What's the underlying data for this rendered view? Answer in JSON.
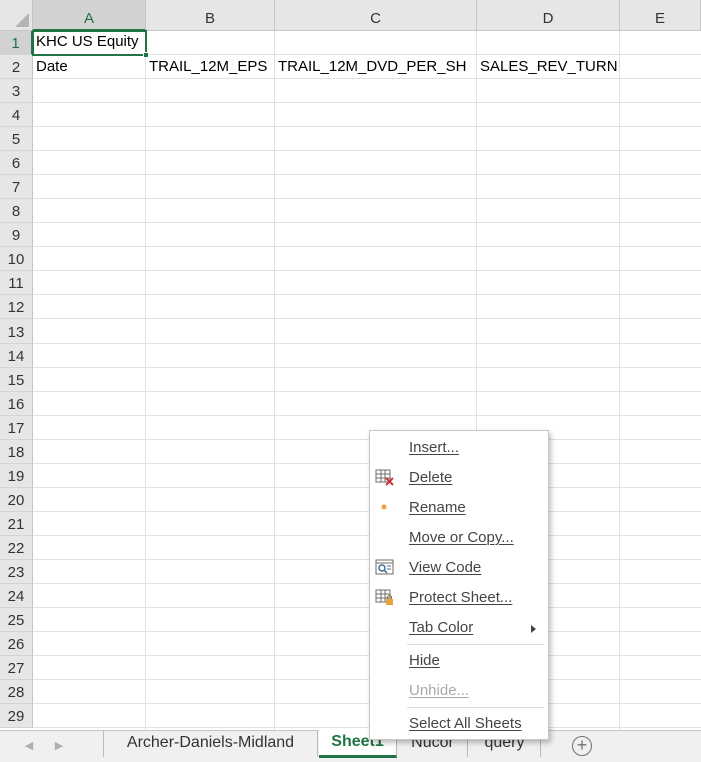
{
  "columns": [
    "A",
    "B",
    "C",
    "D",
    "E"
  ],
  "rows": [
    "1",
    "2",
    "3",
    "4",
    "5",
    "6",
    "7",
    "8",
    "9",
    "10",
    "11",
    "12",
    "13",
    "14",
    "15",
    "16",
    "17",
    "18",
    "19",
    "20",
    "21",
    "22",
    "23",
    "24",
    "25",
    "26",
    "27",
    "28",
    "29"
  ],
  "cells": {
    "a1": "KHC US Equity",
    "a2": "Date",
    "b2": "TRAIL_12M_EPS",
    "c2": "TRAIL_12M_DVD_PER_SH",
    "d2": "SALES_REV_TURN"
  },
  "sheet_tabs": [
    "Archer-Daniels-Midland",
    "Sheet1",
    "Nucor",
    "query"
  ],
  "active_tab": "Sheet1",
  "context_menu": {
    "items": [
      {
        "label": "Insert...",
        "icon": "none",
        "enabled": true
      },
      {
        "label": "Delete",
        "icon": "delete-sheet-icon",
        "enabled": true
      },
      {
        "label": "Rename",
        "icon": "rename-dot-icon",
        "enabled": true
      },
      {
        "label": "Move or Copy...",
        "icon": "none",
        "enabled": true
      },
      {
        "label": "View Code",
        "icon": "view-code-icon",
        "enabled": true
      },
      {
        "label": "Protect Sheet...",
        "icon": "protect-sheet-icon",
        "enabled": true
      },
      {
        "label": "Tab Color",
        "icon": "none",
        "enabled": true,
        "submenu": true
      },
      {
        "label": "Hide",
        "icon": "none",
        "enabled": true
      },
      {
        "label": "Unhide...",
        "icon": "none",
        "enabled": false
      },
      {
        "label": "Select All Sheets",
        "icon": "none",
        "enabled": true
      }
    ]
  },
  "colors": {
    "accent": "#217346",
    "header_bg": "#e6e6e6",
    "gridline": "#e1e1e1"
  }
}
